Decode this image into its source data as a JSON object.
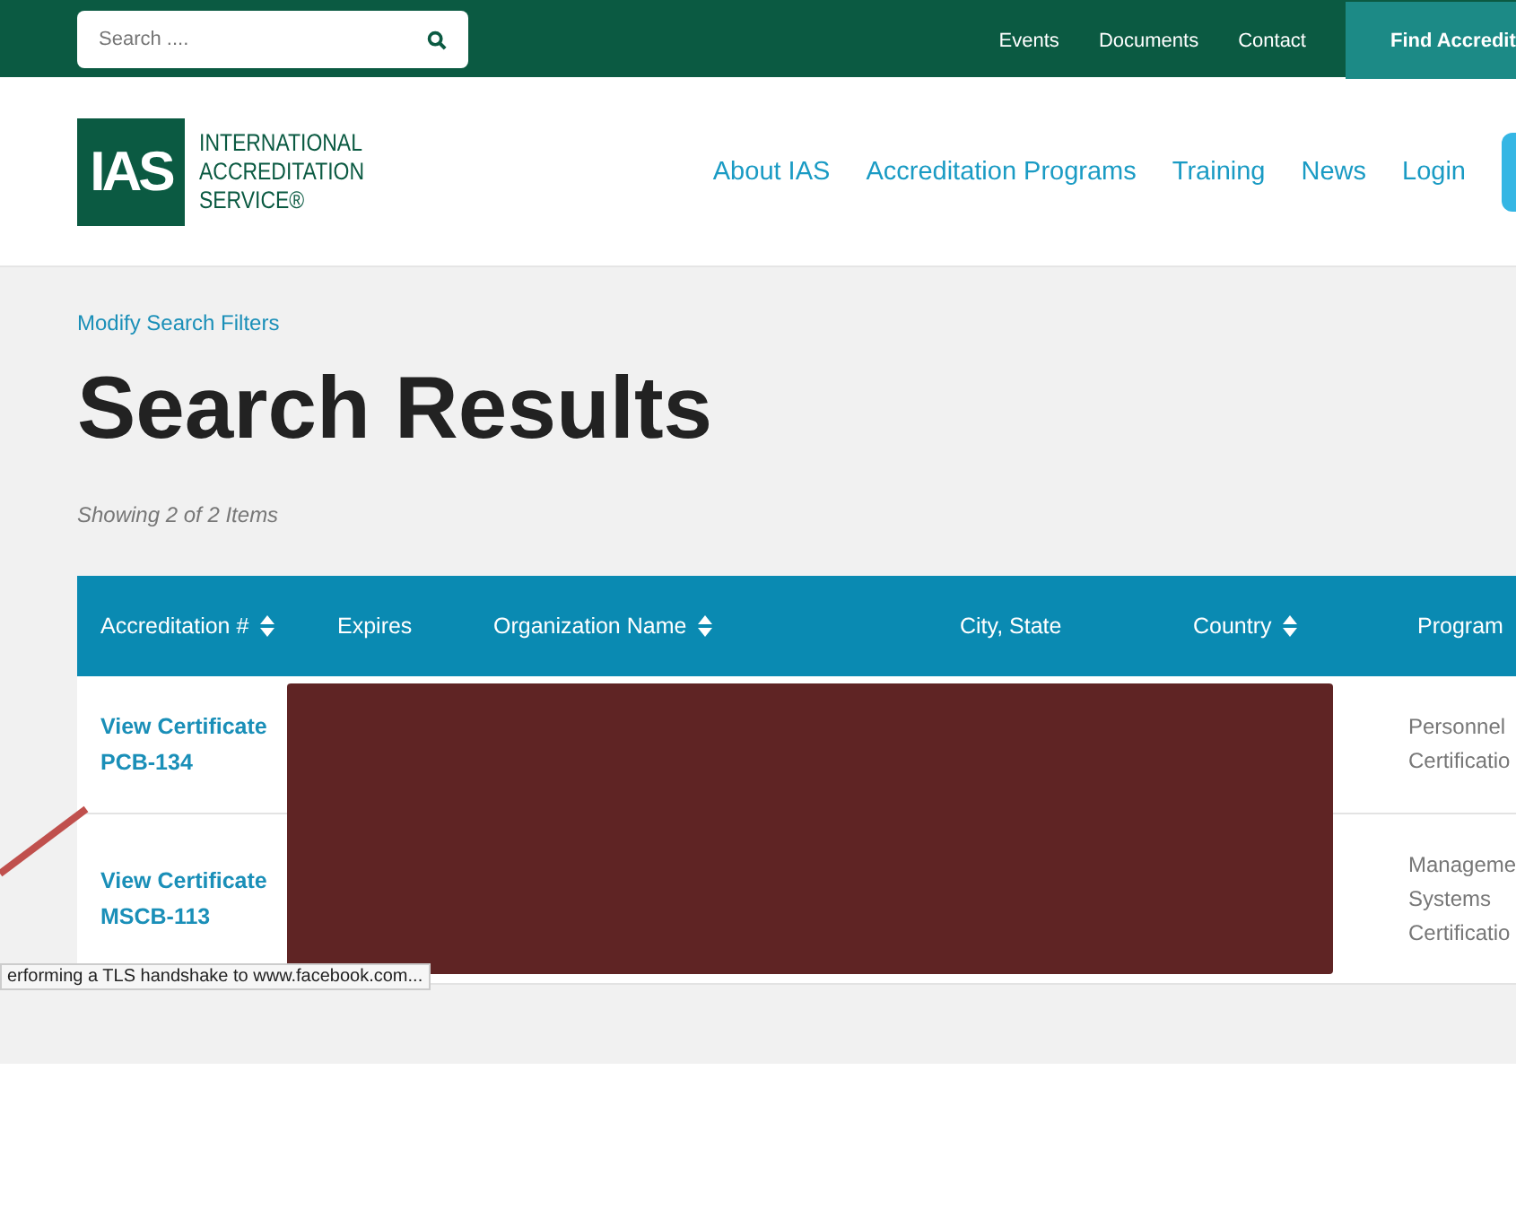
{
  "topbar": {
    "search": {
      "placeholder": "Search ...."
    },
    "links": [
      "Events",
      "Documents",
      "Contact"
    ],
    "cta": "Find Accredit"
  },
  "header": {
    "logo_mark": "IAS",
    "logo_lines": [
      "INTERNATIONAL",
      "ACCREDITATION",
      "SERVICE®"
    ],
    "nav": [
      "About IAS",
      "Accreditation Programs",
      "Training",
      "News",
      "Login"
    ]
  },
  "breadcrumb": "Modify Search Filters",
  "title": "Search Results",
  "count": "Showing 2 of 2 Items",
  "table": {
    "columns": [
      {
        "label": "Accreditation #",
        "sortable": true
      },
      {
        "label": "Expires",
        "sortable": false
      },
      {
        "label": "Organization Name",
        "sortable": true
      },
      {
        "label": "City, State",
        "sortable": false
      },
      {
        "label": "Country",
        "sortable": true
      },
      {
        "label": "Program",
        "sortable": false
      }
    ],
    "rows": [
      {
        "link": "View Certificate",
        "id": "PCB-134",
        "program": [
          "Personnel",
          "Certificatio"
        ]
      },
      {
        "link": "View Certificate",
        "id": "MSCB-113",
        "program": [
          "Manageme",
          "Systems",
          "Certificatio"
        ]
      }
    ]
  },
  "status_bar": "erforming a TLS handshake to www.facebook.com..."
}
